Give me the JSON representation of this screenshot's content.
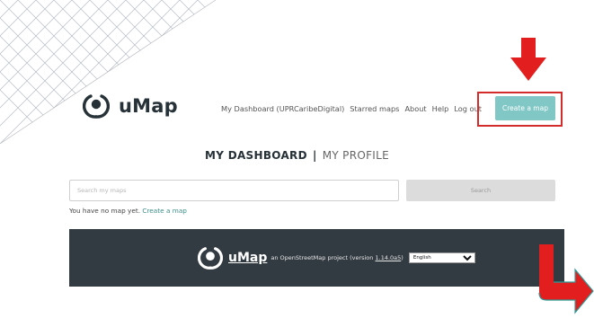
{
  "header": {
    "brand": "uMap",
    "nav": [
      "My Dashboard (UPRCaribeDigital)",
      "Starred maps",
      "About",
      "Help",
      "Log out"
    ],
    "create_button": "Create a map"
  },
  "dashboard": {
    "active_tab": "MY DASHBOARD",
    "separator": "|",
    "inactive_tab": "MY PROFILE"
  },
  "search": {
    "placeholder": "Search my maps",
    "value": "",
    "button": "Search"
  },
  "empty_state": {
    "text": "You have no map yet.",
    "link": "Create a map"
  },
  "footer": {
    "brand": "uMap",
    "text_before": "an OpenStreetMap project (version",
    "version": "1.14.0a5",
    "text_after": ")",
    "language": "English"
  },
  "colors": {
    "accent_teal": "#80c7c5",
    "annotation_red": "#d42b2b",
    "footer_bg": "#323a42"
  }
}
